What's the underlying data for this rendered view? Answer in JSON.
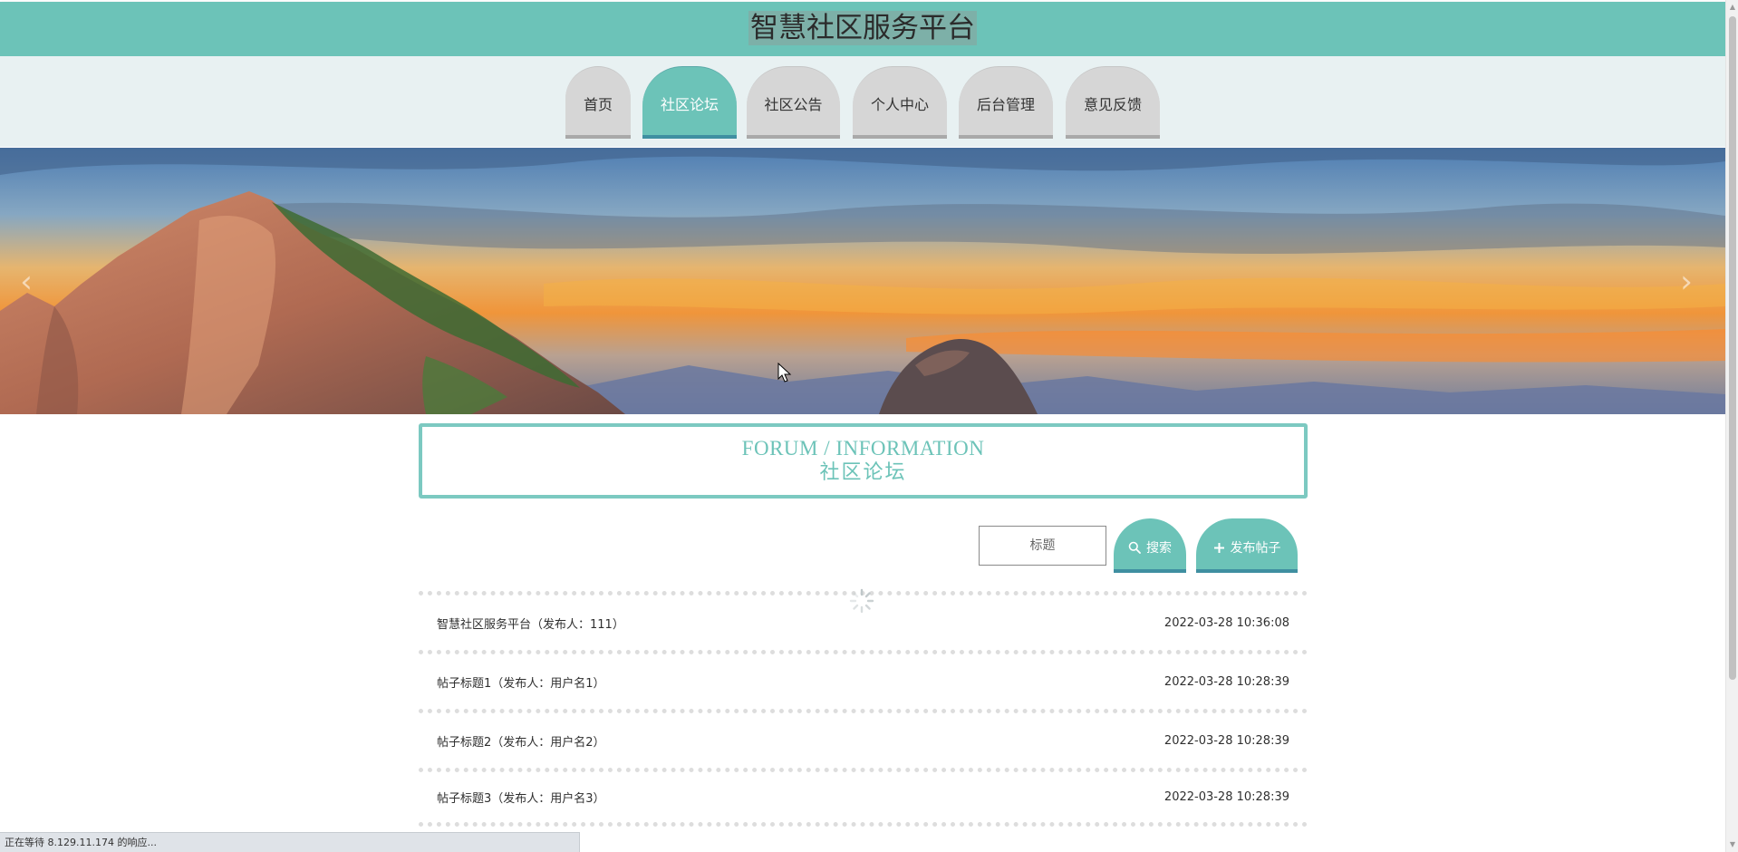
{
  "header": {
    "title": "智慧社区服务平台"
  },
  "nav": {
    "items": [
      {
        "label": "首页",
        "active": false
      },
      {
        "label": "社区论坛",
        "active": true
      },
      {
        "label": "社区公告",
        "active": false
      },
      {
        "label": "个人中心",
        "active": false
      },
      {
        "label": "后台管理",
        "active": false
      },
      {
        "label": "意见反馈",
        "active": false
      }
    ]
  },
  "banner": {
    "prev_icon": "chevron-left-icon",
    "next_icon": "chevron-right-icon"
  },
  "section": {
    "title_en": "FORUM / INFORMATION",
    "title_cn": "社区论坛"
  },
  "search": {
    "placeholder": "标题",
    "search_label": "搜索",
    "publish_label": "发布帖子"
  },
  "posts": [
    {
      "title": "智慧社区服务平台（发布人：111）",
      "time": "2022-03-28 10:36:08"
    },
    {
      "title": "帖子标题1（发布人：用户名1）",
      "time": "2022-03-28 10:28:39"
    },
    {
      "title": "帖子标题2（发布人：用户名2）",
      "time": "2022-03-28 10:28:39"
    },
    {
      "title": "帖子标题3（发布人：用户名3）",
      "time": "2022-03-28 10:28:39"
    }
  ],
  "status": {
    "text": "正在等待 8.129.11.174 的响应..."
  },
  "colors": {
    "accent": "#6cc3b8",
    "accent_dark": "#3f8fa1",
    "nav_bg": "#e8f1f2",
    "inactive_tab": "#d6d6d6"
  }
}
